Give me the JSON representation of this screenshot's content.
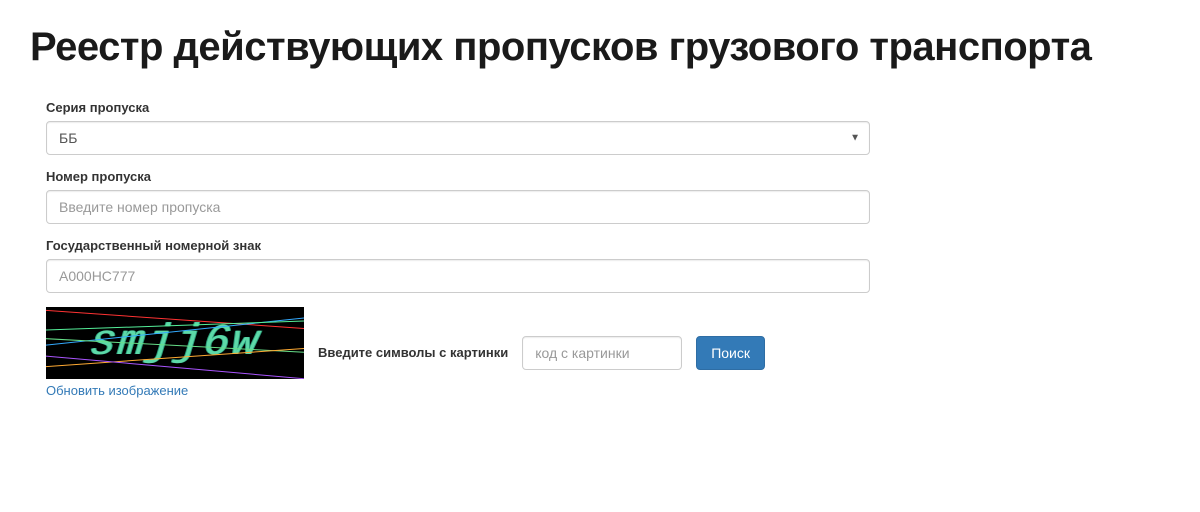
{
  "header": {
    "title": "Реестр действующих пропусков грузового транспорта"
  },
  "form": {
    "series": {
      "label": "Серия пропуска",
      "value": "ББ"
    },
    "number": {
      "label": "Номер пропуска",
      "placeholder": "Введите номер пропуска"
    },
    "plate": {
      "label": "Государственный номерной знак",
      "placeholder": "А000НС777"
    },
    "captcha": {
      "image_text": "smjj6w",
      "refresh_label": "Обновить изображение",
      "prompt_label": "Введите символы с картинки",
      "input_placeholder": "код с картинки"
    },
    "submit": {
      "label": "Поиск"
    }
  }
}
